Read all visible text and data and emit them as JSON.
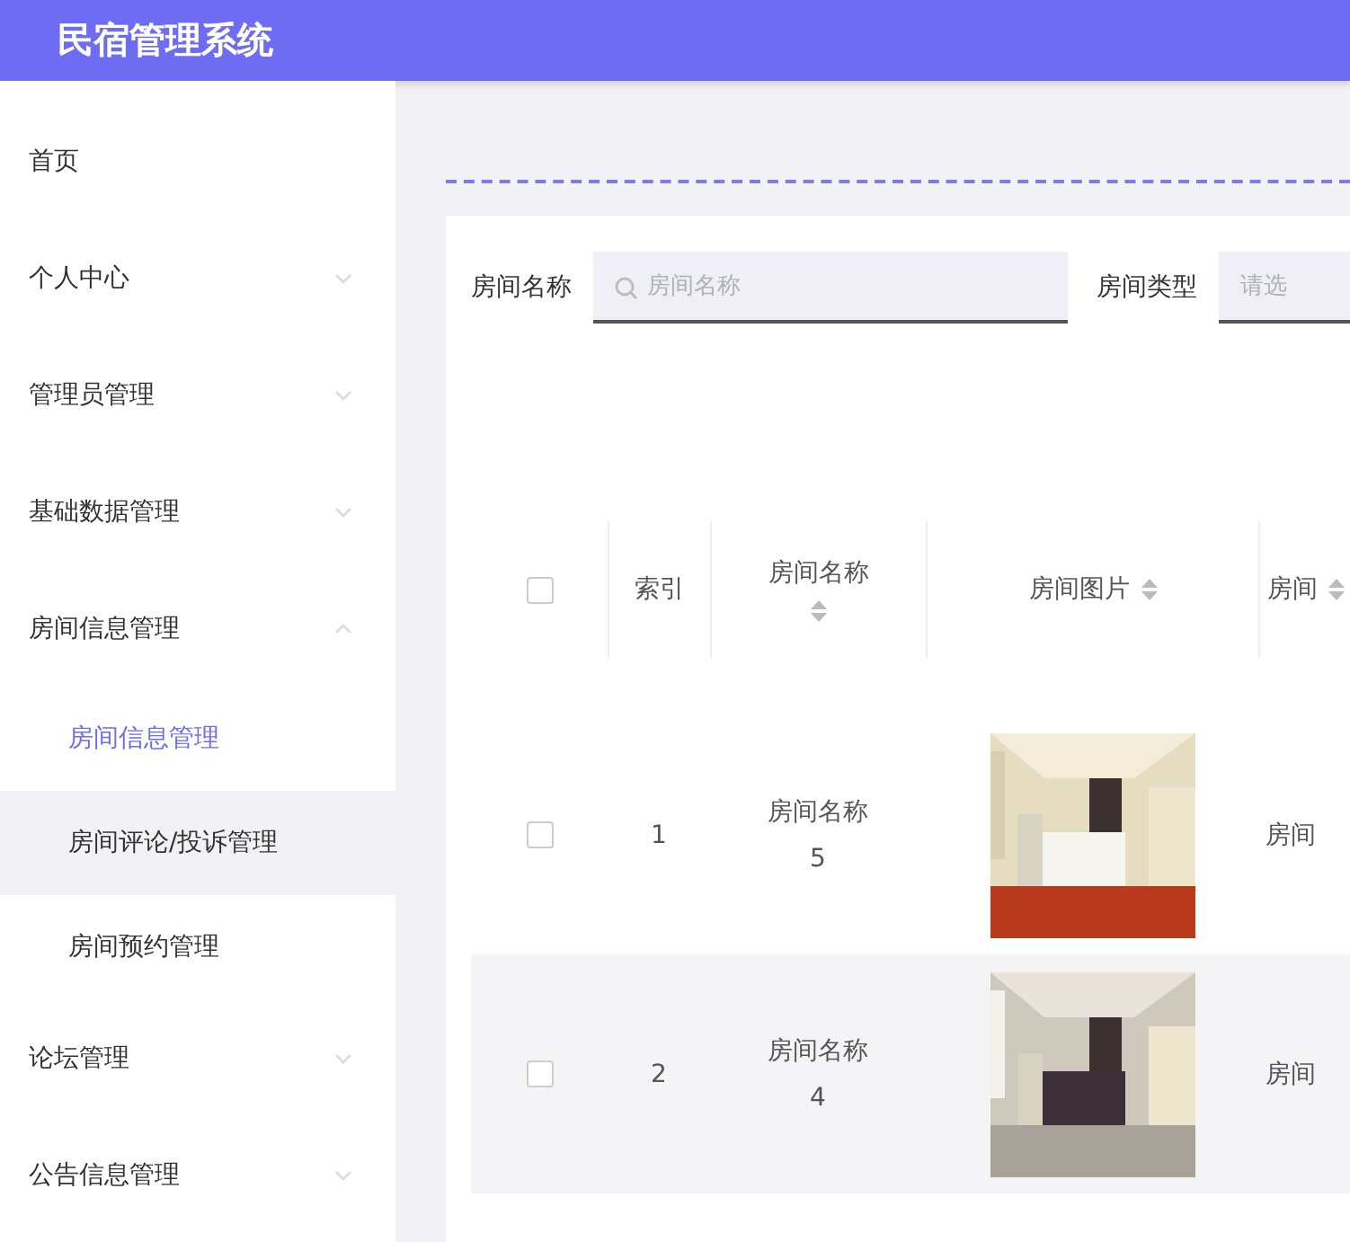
{
  "header": {
    "title": "民宿管理系统"
  },
  "sidebar": {
    "items": [
      {
        "label": "首页",
        "kind": "link"
      },
      {
        "label": "个人中心",
        "kind": "group",
        "expanded": false
      },
      {
        "label": "管理员管理",
        "kind": "group",
        "expanded": false
      },
      {
        "label": "基础数据管理",
        "kind": "group",
        "expanded": false
      },
      {
        "label": "房间信息管理",
        "kind": "group",
        "expanded": true,
        "children": [
          {
            "label": "房间信息管理",
            "selected": true,
            "highlighted": false
          },
          {
            "label": "房间评论/投诉管理",
            "selected": false,
            "highlighted": true
          },
          {
            "label": "房间预约管理",
            "selected": false,
            "highlighted": false
          }
        ]
      },
      {
        "label": "论坛管理",
        "kind": "group",
        "expanded": false
      },
      {
        "label": "公告信息管理",
        "kind": "group",
        "expanded": false
      }
    ]
  },
  "search": {
    "fields": [
      {
        "label": "房间名称",
        "kind": "text",
        "placeholder": "房间名称"
      },
      {
        "label": "房间类型",
        "kind": "select",
        "placeholder": "请选"
      }
    ]
  },
  "table": {
    "columns": [
      {
        "kind": "checkbox",
        "checked": false
      },
      {
        "kind": "text",
        "label": "索引",
        "sortable": false
      },
      {
        "kind": "text",
        "label": "房间名称",
        "sortable": true
      },
      {
        "kind": "text",
        "label": "房间图片",
        "sortable": true
      },
      {
        "kind": "text",
        "label": "房间",
        "sortable": true
      }
    ],
    "rows": [
      {
        "checked": false,
        "index": "1",
        "name": [
          "房间名称",
          "5"
        ],
        "picture": {
          "kind": "picture"
        },
        "column_5": "房间"
      },
      {
        "checked": false,
        "index": "2",
        "name": [
          "房间名称",
          "4"
        ],
        "picture": {
          "kind": "picture"
        },
        "column_5": "房间"
      }
    ]
  }
}
